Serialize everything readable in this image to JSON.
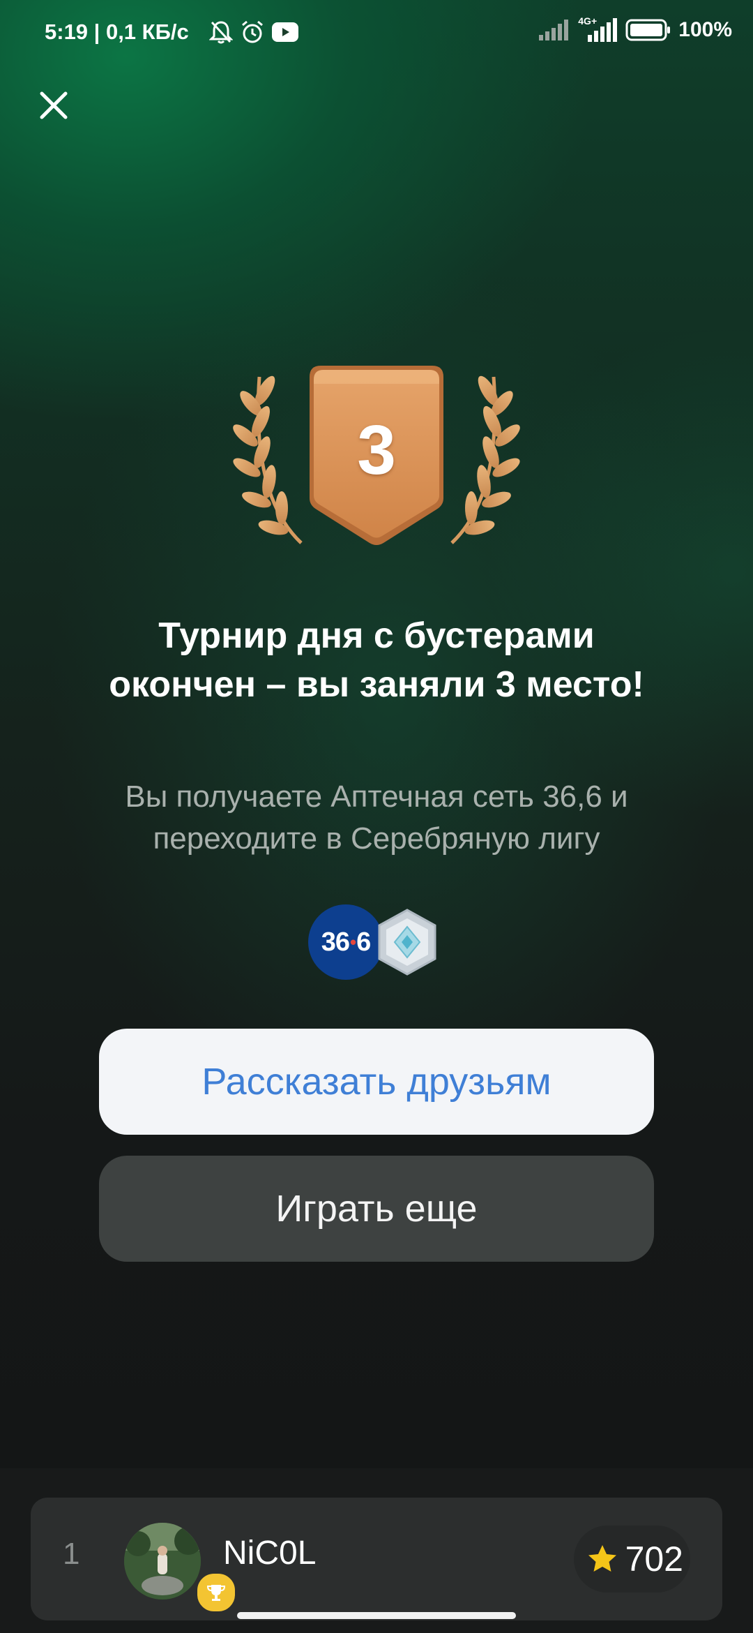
{
  "status_bar": {
    "time": "5:19",
    "speed": "| 0,1 КБ/с",
    "network": "4G+",
    "battery": "100%"
  },
  "result": {
    "rank": "3",
    "title": "Турнир дня с бустерами окончен – вы заняли 3 место!",
    "subtitle": "Вы получаете Аптечная сеть 36,6 и переходите в Серебряную лигу",
    "pharmacy_logo_left": "36",
    "pharmacy_logo_right": "6"
  },
  "buttons": {
    "share": "Рассказать друзьям",
    "play_again": "Играть еще"
  },
  "leaderboard": {
    "rows": [
      {
        "rank": "1",
        "name": "NiC0L",
        "score": "702"
      }
    ]
  },
  "colors": {
    "accent_blue": "#3f7fd6",
    "medal_bronze": "#d9955a",
    "trophy_gold": "#f3c432"
  }
}
